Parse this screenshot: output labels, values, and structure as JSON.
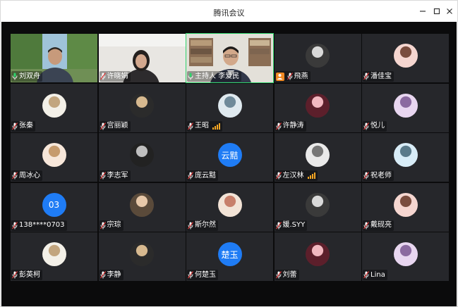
{
  "window": {
    "title": "腾讯会议",
    "controls": [
      "minimize-icon",
      "maximize-icon",
      "close-icon"
    ]
  },
  "colors": {
    "stage": "#0b0b0c",
    "tile": "#26272b",
    "active_border": "#2fd46b",
    "text_avatar": "#1f7cf5",
    "signal": "#f5a623",
    "host_badge": "#f08a24"
  },
  "participants": [
    {
      "name": "刘双舟",
      "mic": "on",
      "video": true,
      "avatar": "photo-man-outdoor"
    },
    {
      "name": "许晓娟",
      "mic": "muted",
      "video": true,
      "avatar": "photo-woman-office"
    },
    {
      "name": "主持人 李爱民",
      "mic": "on",
      "video": true,
      "avatar": "photo-man-bookshelf",
      "active": true
    },
    {
      "name": "飛燕",
      "mic": "muted",
      "video": false,
      "avatar": "photo",
      "host_badge": true
    },
    {
      "name": "潘佳宝",
      "mic": "muted",
      "video": false,
      "avatar": "photo"
    },
    {
      "name": "张秦",
      "mic": "muted",
      "video": false,
      "avatar": "photo"
    },
    {
      "name": "宫丽颖",
      "mic": "muted",
      "video": false,
      "avatar": "photo"
    },
    {
      "name": "王昭",
      "mic": "muted",
      "video": false,
      "avatar": "photo",
      "signal": true
    },
    {
      "name": "许静涛",
      "mic": "muted",
      "video": false,
      "avatar": "photo"
    },
    {
      "name": "悦儿",
      "mic": "muted",
      "video": false,
      "avatar": "photo"
    },
    {
      "name": "周冰心",
      "mic": "muted",
      "video": false,
      "avatar": "photo"
    },
    {
      "name": "李志军",
      "mic": "muted",
      "video": false,
      "avatar": "photo"
    },
    {
      "name": "庞云黠",
      "mic": "muted",
      "video": false,
      "avatar_text": "云黠"
    },
    {
      "name": "左汉林",
      "mic": "muted",
      "video": false,
      "avatar": "photo",
      "signal": true
    },
    {
      "name": "祝老师",
      "mic": "muted",
      "video": false,
      "avatar": "photo"
    },
    {
      "name": "138****0703",
      "mic": "muted",
      "video": false,
      "avatar_text": "03"
    },
    {
      "name": "宗琮",
      "mic": "muted",
      "video": false,
      "avatar": "photo"
    },
    {
      "name": "斯尔然",
      "mic": "muted",
      "video": false,
      "avatar": "photo"
    },
    {
      "name": "媛.SYY",
      "mic": "muted",
      "video": false,
      "avatar": "photo"
    },
    {
      "name": "戴砚亮",
      "mic": "muted",
      "video": false,
      "avatar": "photo"
    },
    {
      "name": "彭英柯",
      "mic": "muted",
      "video": false,
      "avatar": "photo"
    },
    {
      "name": "李静",
      "mic": "muted",
      "video": false,
      "avatar": "photo"
    },
    {
      "name": "何楚玉",
      "mic": "muted",
      "video": false,
      "avatar_text": "楚玉"
    },
    {
      "name": "刘蕾",
      "mic": "muted",
      "video": false,
      "avatar": "photo"
    },
    {
      "name": "Lina",
      "mic": "muted",
      "video": false,
      "avatar": "photo"
    }
  ]
}
